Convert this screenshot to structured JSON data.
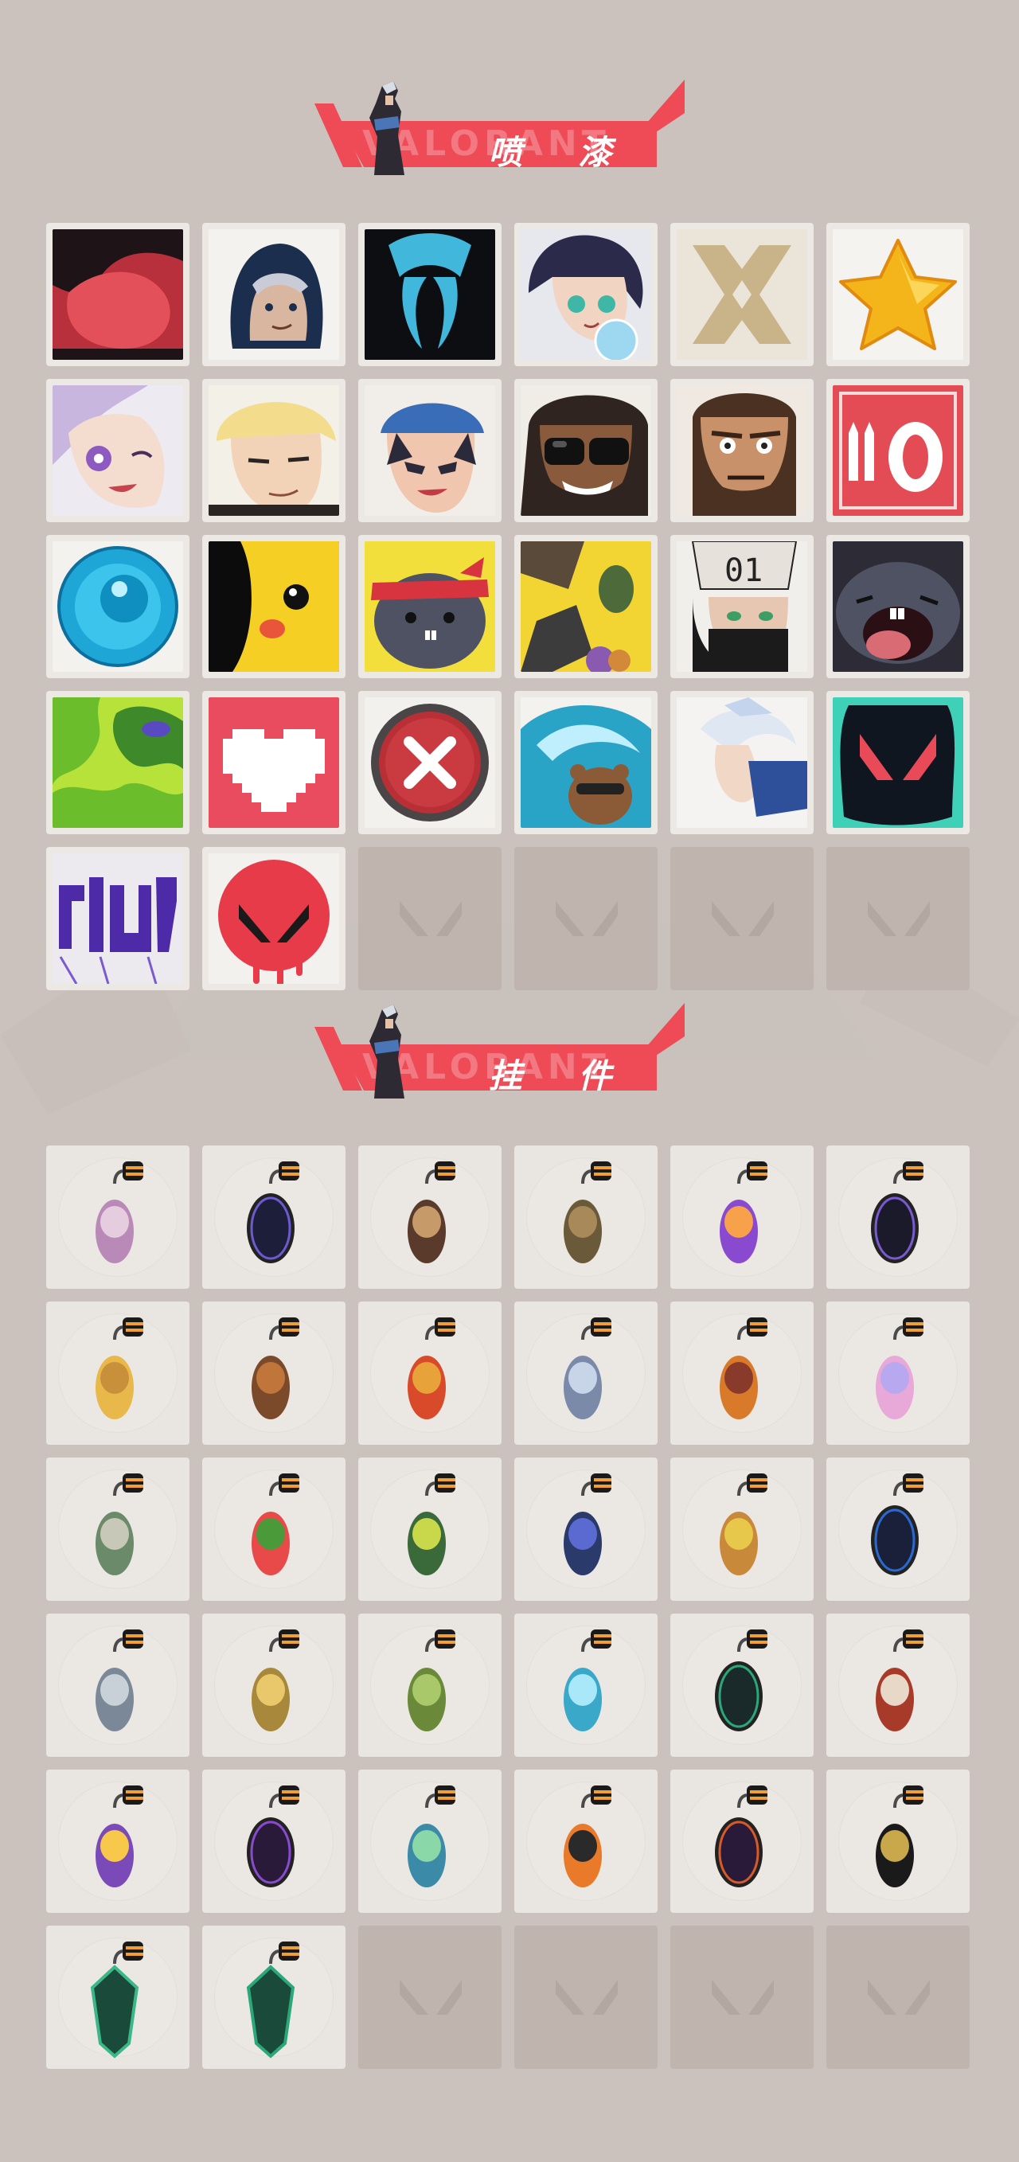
{
  "sections": [
    {
      "title": "喷 漆",
      "ghost_text": "VALORANT"
    },
    {
      "title": "挂 件",
      "ghost_text": "VALORANT"
    }
  ],
  "sprays": [
    "red-blob-spray",
    "hooded-agent-spray",
    "blue-mark-spray",
    "girl-bubble-spray",
    "gold-x-spray",
    "gold-star-spray",
    "wink-girl-spray",
    "blonde-agent-spray",
    "blue-cap-agent-spray",
    "sunglasses-agent-spray",
    "bearded-agent-spray",
    "ammo-zero-spray",
    "blue-orb-spray",
    "yellow-creature-spray",
    "bunny-headband-spray",
    "gauntlet-grenade-spray",
    "masked-agent-01-spray",
    "screaming-creature-spray",
    "green-slime-spray",
    "pixel-heart-spray",
    "red-x-button-spray",
    "wave-bear-spray",
    "white-hair-agent-spray",
    "valorant-logo-splash-spray",
    "purple-graffiti-spray",
    "red-drip-logo-spray"
  ],
  "charms": [
    "cupcake-charm",
    "ep9-badge-charm",
    "agent-figure-charm",
    "cowboy-figure-charm",
    "lava-lamp-charm",
    "ep9-badge-dark-charm",
    "taco-charm",
    "popsicle-charm",
    "skewer-charm",
    "agent-keytag-charm",
    "hot-air-balloon-charm",
    "pink-hair-charm",
    "robot-charm",
    "watermelon-charm",
    "can-charm",
    "lantern-charm",
    "honey-pot-charm",
    "ep9-badge-blue-charm",
    "hook-charm",
    "gold-robot-charm",
    "green-head-charm",
    "blue-blade-charm",
    "ep8-badge-charm",
    "bottle-charm",
    "lotus-flame-charm",
    "ep8-badge-purple-charm",
    "ufo-charm",
    "tiger-charm",
    "ep7-badge-charm",
    "valorant-tag-charm",
    "ep9-gem-charm",
    "ep8-gem-charm"
  ],
  "empty_slot_count_sprays": 4,
  "empty_slot_count_charms": 4,
  "colors": {
    "background": "#cbc2bd",
    "banner": "#ee4b57",
    "tile": "#ece8e3",
    "empty_tile": "#bfb5ae"
  }
}
